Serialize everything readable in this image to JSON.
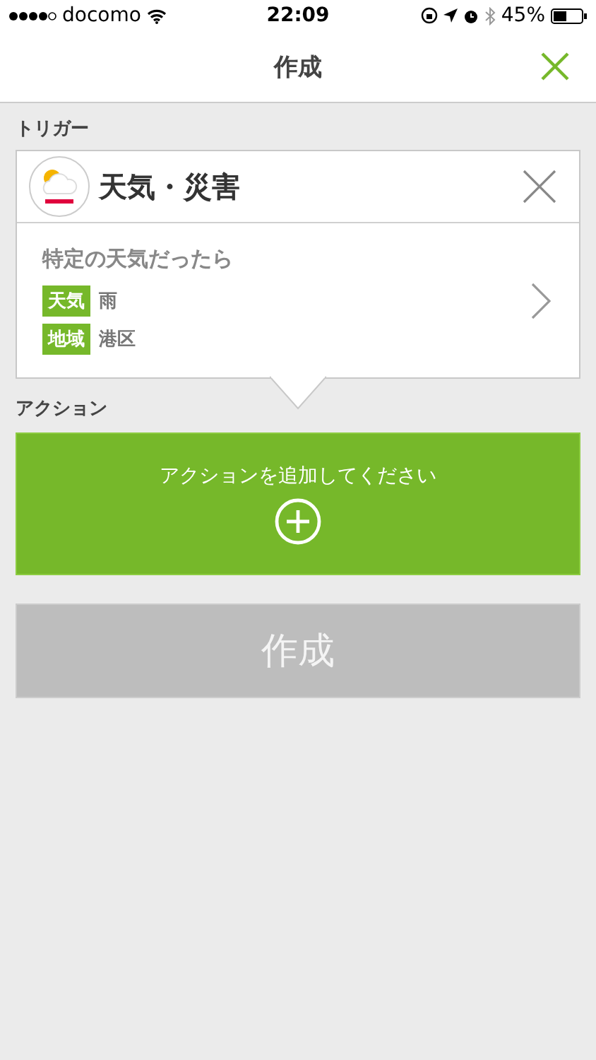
{
  "status_bar": {
    "carrier": "docomo",
    "time": "22:09",
    "battery": "45%"
  },
  "nav": {
    "title": "作成"
  },
  "trigger": {
    "label": "トリガー",
    "service": "天気・災害",
    "condition": "特定の天気だったら",
    "params": [
      {
        "tag": "天気",
        "value": "雨"
      },
      {
        "tag": "地域",
        "value": "港区"
      }
    ]
  },
  "action": {
    "label": "アクション",
    "prompt": "アクションを追加してください"
  },
  "create_button": {
    "label": "作成",
    "disabled": true
  }
}
